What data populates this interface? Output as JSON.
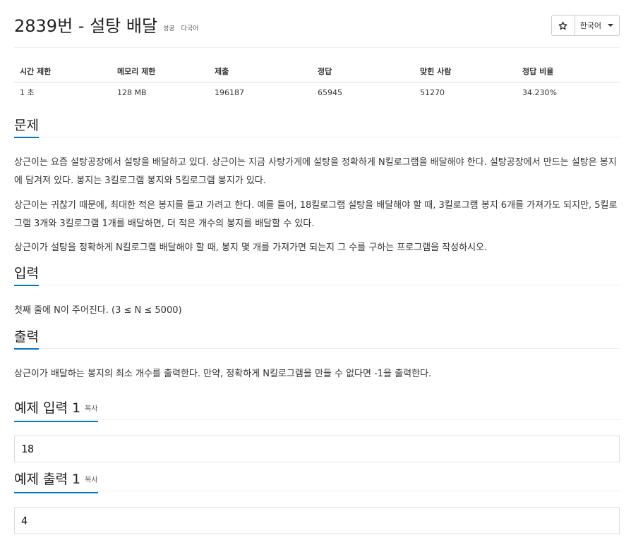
{
  "problem": {
    "number_title": "2839번 - 설탕 배달",
    "labels": [
      "성공",
      "다국어"
    ]
  },
  "toolbar": {
    "star_icon": "star-icon",
    "language": "한국어"
  },
  "info_table": {
    "headers": [
      "시간 제한",
      "메모리 제한",
      "제출",
      "정답",
      "맞힌 사람",
      "정답 비율"
    ],
    "values": [
      "1 초",
      "128 MB",
      "196187",
      "65945",
      "51270",
      "34.230%"
    ]
  },
  "sections": {
    "description_title": "문제",
    "description": [
      "상근이는 요즘 설탕공장에서 설탕을 배달하고 있다. 상근이는 지금 사탕가게에 설탕을 정확하게 N킬로그램을 배달해야 한다. 설탕공장에서 만드는 설탕은 봉지에 담겨져 있다. 봉지는 3킬로그램 봉지와 5킬로그램 봉지가 있다.",
      "상근이는 귀찮기 때문에, 최대한 적은 봉지를 들고 가려고 한다. 예를 들어, 18킬로그램 설탕을 배달해야 할 때, 3킬로그램 봉지 6개를 가져가도 되지만, 5킬로그램 3개와 3킬로그램 1개를 배달하면, 더 적은 개수의 봉지를 배달할 수 있다.",
      "상근이가 설탕을 정확하게 N킬로그램 배달해야 할 때, 봉지 몇 개를 가져가면 되는지 그 수를 구하는 프로그램을 작성하시오."
    ],
    "input_title": "입력",
    "input_text": "첫째 줄에 N이 주어진다. (3 ≤ N ≤ 5000)",
    "output_title": "출력",
    "output_text": "상근이가 배달하는 봉지의 최소 개수를 출력한다. 만약, 정확하게 N킬로그램을 만들 수 없다면 -1을 출력한다.",
    "sample_input_title": "예제 입력 1",
    "sample_output_title": "예제 출력 1",
    "copy_label": "복사",
    "sample_input": "18",
    "sample_output": "4"
  },
  "colors": {
    "accent": "#0076c0"
  }
}
